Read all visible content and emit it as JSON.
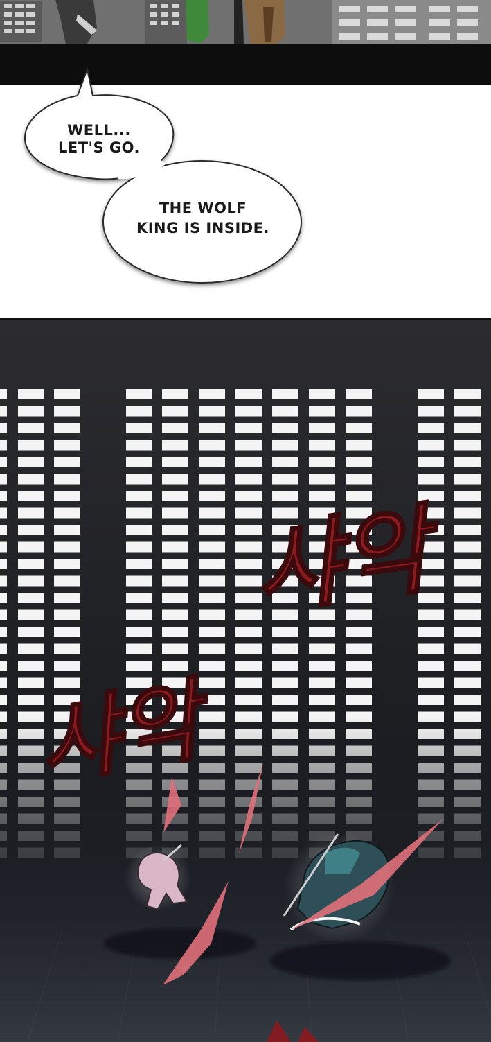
{
  "dialogue": {
    "bubble_1": {
      "line_1": "WELL...",
      "line_2": "LET'S GO."
    },
    "bubble_2": {
      "line_1": "THE WOLF",
      "line_2": "KING IS INSIDE."
    }
  },
  "sound_effects": {
    "sfx_upper": "샤악",
    "sfx_lower": "샤악"
  },
  "colors": {
    "sfx_red": "#8c1a1f",
    "slash_red": "#e0707a",
    "panel_dark": "#222428",
    "window_white": "#f4f4f4"
  }
}
